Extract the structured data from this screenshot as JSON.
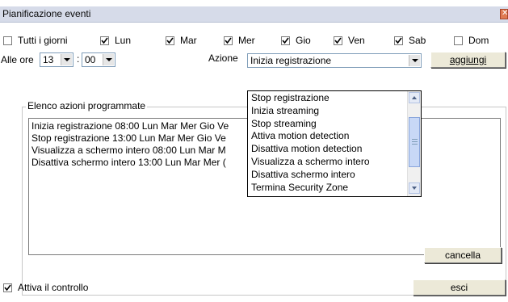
{
  "window": {
    "title": "Pianificazione eventi",
    "close_icon": "close-icon"
  },
  "days": [
    {
      "label": "Tutti i giorni",
      "checked": false
    },
    {
      "label": "Lun",
      "checked": true
    },
    {
      "label": "Mar",
      "checked": true
    },
    {
      "label": "Mer",
      "checked": true
    },
    {
      "label": "Gio",
      "checked": true
    },
    {
      "label": "Ven",
      "checked": true
    },
    {
      "label": "Sab",
      "checked": true
    },
    {
      "label": "Dom",
      "checked": false
    }
  ],
  "time": {
    "label": "Alle ore",
    "hour": "13",
    "separator": ":",
    "minute": "00"
  },
  "action": {
    "label": "Azione",
    "selected": "Inizia registrazione",
    "add_button": "aggiungi",
    "options": [
      "Stop registrazione",
      "Inizia streaming",
      "Stop streaming",
      "Attiva motion detection",
      "Disattiva motion detection",
      "Visualizza a schermo intero",
      "Disattiva schermo intero",
      "Termina Security Zone"
    ]
  },
  "scheduled": {
    "legend": "Elenco azioni programmate",
    "items": [
      "Inizia registrazione 08:00 Lun Mar Mer Gio Ve",
      "Stop registrazione 13:00 Lun Mar Mer Gio Ve",
      "Visualizza a schermo intero 08:00 Lun Mar M",
      "Disattiva schermo intero 13:00 Lun Mar Mer ("
    ],
    "delete_button": "cancella"
  },
  "footer": {
    "enable_label": "Attiva il controllo",
    "enable_checked": true,
    "exit_button": "esci"
  },
  "colors": {
    "titlebar": "#d6dbe9",
    "button_face": "#ece9d8",
    "scrollbar_thumb": "#c8d8f6"
  }
}
